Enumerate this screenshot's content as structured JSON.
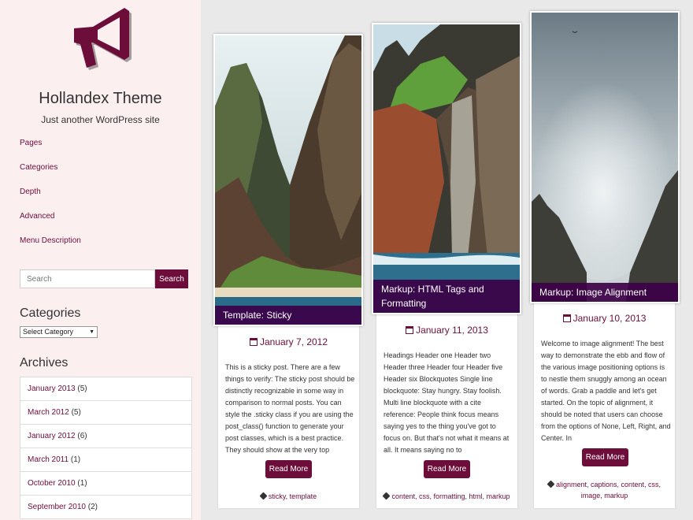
{
  "site": {
    "title": "Hollandex Theme",
    "tagline": "Just another WordPress site",
    "accent_color": "#6d0d3a",
    "logo_icon": "megaphone-icon"
  },
  "nav": [
    "Pages",
    "Categories",
    "Depth",
    "Advanced",
    "Menu Description"
  ],
  "search": {
    "placeholder": "Search",
    "button": "Search"
  },
  "widgets": {
    "categories_title": "Categories",
    "select_category": "Select Category",
    "archives_title": "Archives",
    "archives": [
      {
        "label": "January 2013",
        "count": "(5)"
      },
      {
        "label": "March 2012",
        "count": "(5)"
      },
      {
        "label": "January 2012",
        "count": "(6)"
      },
      {
        "label": "March 2011",
        "count": "(1)"
      },
      {
        "label": "October 2010",
        "count": "(1)"
      },
      {
        "label": "September 2010",
        "count": "(2)"
      }
    ]
  },
  "posts": [
    {
      "title": "Template: Sticky",
      "date": "January 7, 2012",
      "excerpt": "This is a sticky post. There are a few things to verify: The sticky post should be distinctly recognizable in some way in comparison to normal posts. You can style the .sticky class if you are using the post_class() function to generate your post classes, which is a best practice. They should show at the very top",
      "button": "Read More",
      "tags": "sticky, template"
    },
    {
      "title": "Markup: HTML Tags and Formatting",
      "date": "January 11, 2013",
      "excerpt": "Headings Header one Header two Header three Header four Header five Header six Blockquotes Single line blockquote: Stay hungry. Stay foolish. Multi line blockquote with a cite reference: People think focus means saying yes to the thing you've got to focus on. But that's not what it means at all. It means saying no to",
      "button": "Read More",
      "tags": "content, css, formatting, html, markup"
    },
    {
      "title": "Markup: Image Alignment",
      "date": "January 10, 2013",
      "excerpt": "Welcome to image alignment! The best way to demonstrate the ebb and flow of the various image positioning options is to nestle them snuggly among an ocean of words. Grab a paddle and let's get started. On the topic of alignment, it should be noted that users can choose from the options of None, Left, Right, and Center. In",
      "button": "Read More",
      "tags_line1": "alignment, captions, content, css,",
      "tags_line2": "image, markup"
    }
  ]
}
